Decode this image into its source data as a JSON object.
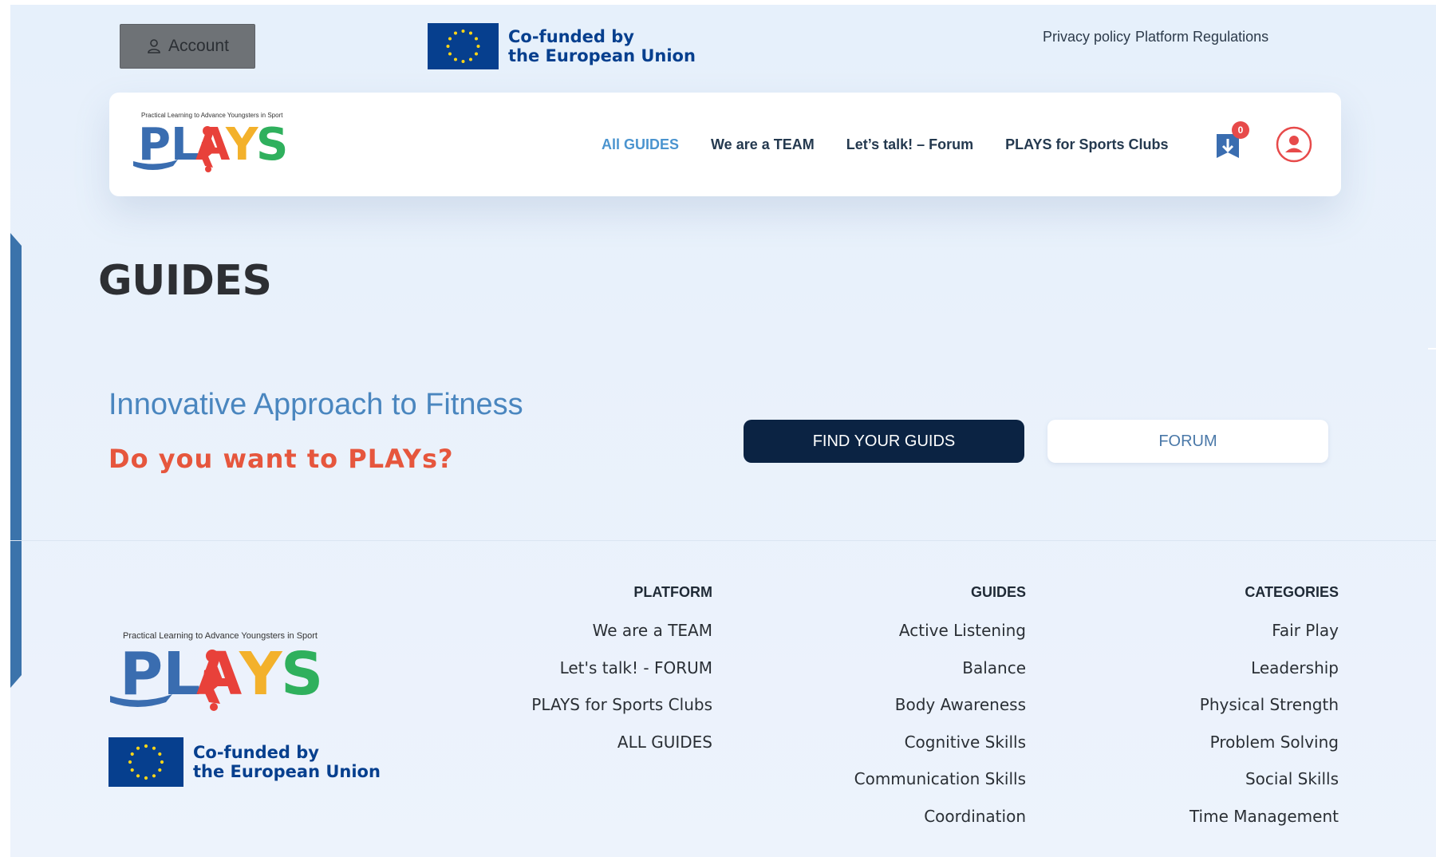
{
  "topbar": {
    "account_label": "Account",
    "eu_line1": "Co-funded by",
    "eu_line2": "the European Union",
    "links": [
      "Privacy policy",
      "Platform Regulations"
    ]
  },
  "header": {
    "logo_tagline": "Practical Learning to Advance Youngsters in Sport",
    "logo_word": "PLAYS",
    "nav": [
      {
        "label": "All GUIDES",
        "active": true
      },
      {
        "label": "We are a TEAM",
        "active": false
      },
      {
        "label": "Let’s talk! – Forum",
        "active": false
      },
      {
        "label": "PLAYS for Sports Clubs",
        "active": false
      }
    ],
    "download_count": "0"
  },
  "main": {
    "title": "GUIDES",
    "subtitle": "Innovative Approach to Fitness",
    "question": "Do you want to PLAYs?",
    "find_button": "FIND YOUR GUIDS",
    "forum_button": "FORUM"
  },
  "footer": {
    "logo_tagline": "Practical Learning to Advance Youngsters in Sport",
    "logo_word": "PLAYS",
    "eu_line1": "Co-funded by",
    "eu_line2": "the European Union",
    "platform": {
      "heading": "PLATFORM",
      "items": [
        "We are a TEAM",
        "Let's talk! - FORUM",
        "PLAYS for Sports Clubs",
        "ALL GUIDES"
      ]
    },
    "guides": {
      "heading": "GUIDES",
      "items": [
        "Active Listening",
        "Balance",
        "Body Awareness",
        "Cognitive Skills",
        "Communication Skills",
        "Coordination"
      ]
    },
    "categories": {
      "heading": "CATEGORIES",
      "items": [
        "Fair Play",
        "Leadership",
        "Physical Strength",
        "Problem Solving",
        "Social Skills",
        "Time Management"
      ]
    }
  },
  "colors": {
    "accent_blue": "#4b94cf",
    "dark_navy": "#0b2343",
    "hero_red": "#e6563d",
    "eu_blue": "#063f8e"
  }
}
